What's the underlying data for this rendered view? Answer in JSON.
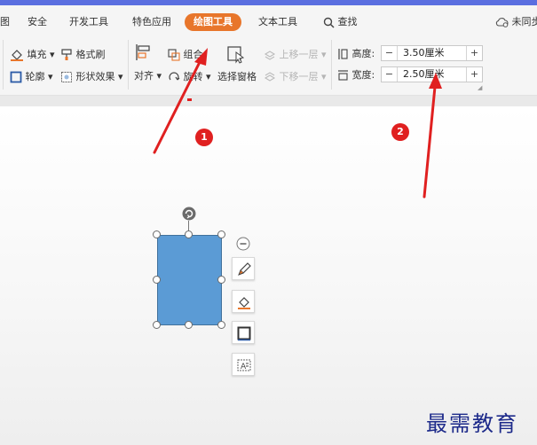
{
  "colors": {
    "accent": "#e8762b",
    "shape_fill": "#5b9bd5",
    "marker": "#e02020",
    "watermark": "#1d2a8a"
  },
  "tabs": [
    {
      "label": "图"
    },
    {
      "label": "安全"
    },
    {
      "label": "开发工具"
    },
    {
      "label": "特色应用"
    },
    {
      "label": "绘图工具",
      "active": true
    },
    {
      "label": "文本工具"
    },
    {
      "label": "查找",
      "icon": "search-icon"
    },
    {
      "label": "未同步",
      "icon": "cloud-sync-icon"
    }
  ],
  "ribbon": {
    "fill": "填充",
    "format_painter": "格式刷",
    "outline": "轮廓",
    "shape_effects": "形状效果",
    "align": "对齐",
    "group": "组合",
    "rotate": "旋转",
    "selection_pane": "选择窗格",
    "bring_forward": "上移一层",
    "send_backward": "下移一层",
    "height_label": "高度:",
    "height_value": "3.50厘米",
    "width_label": "宽度:",
    "width_value": "2.50厘米",
    "minus": "−",
    "plus": "+"
  },
  "annotations": {
    "marker_1": "1",
    "marker_2": "2"
  },
  "watermark": "最需教育"
}
